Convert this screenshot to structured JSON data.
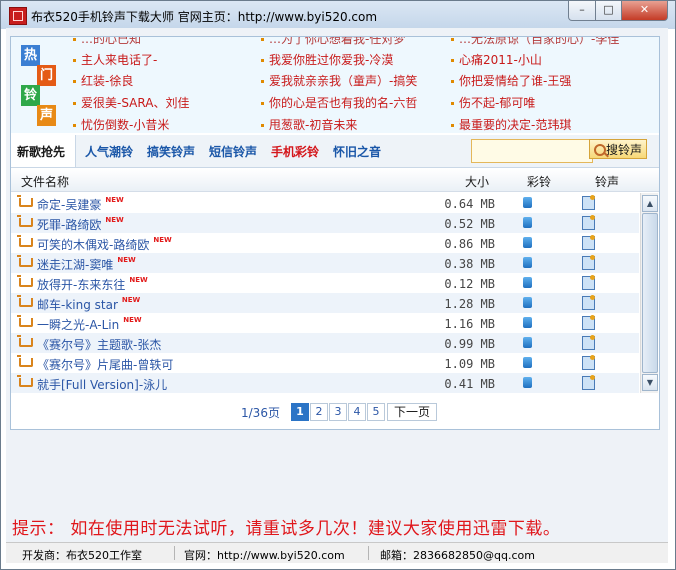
{
  "window": {
    "title": "布衣520手机铃声下载大师  官网主页：http://www.byi520.com",
    "min_label": "–",
    "max_label": "□",
    "close_label": "✕"
  },
  "banner": {
    "tiles": [
      "热",
      "门",
      "铃",
      "声"
    ],
    "tile_colors": [
      "#3b7fd3",
      "#e45b16",
      "#2fa84a",
      "#e88a16"
    ],
    "columns": [
      [
        "主人来电话了-",
        "红装-徐良",
        "爱很美-SARA、刘佳",
        "忧伤倒数-小昔米"
      ],
      [
        "我爱你胜过你爱我-冷漠",
        "爱我就亲亲我（童声）-搞笑",
        "你的心是否也有我的名-六哲",
        "甩葱歌-初音未来"
      ],
      [
        "心痛2011-小山",
        "你把爱情给了谁-王强",
        "伤不起-郁可唯",
        "最重要的决定-范玮琪"
      ]
    ],
    "partial_top": [
      "…的心已知",
      "…为了你心想着我-任对梦",
      "…无法原谅（自家的心）-李佳"
    ]
  },
  "tabs": [
    "新歌抢先",
    "人气潮铃",
    "搞笑铃声",
    "短信铃声",
    "手机彩铃",
    "怀旧之音"
  ],
  "search": {
    "value": "",
    "placeholder": "",
    "button_label": "搜铃声"
  },
  "list": {
    "headers": {
      "name": "文件名称",
      "size": "大小",
      "color_ring": "彩铃",
      "ringtone": "铃声"
    },
    "new_badge": "NEW",
    "rows": [
      {
        "name": "命定-吴建豪",
        "is_new": true,
        "size": "0.64 MB"
      },
      {
        "name": "死罪-路绮欧",
        "is_new": true,
        "size": "0.52 MB"
      },
      {
        "name": "可笑的木偶戏-路绮欧",
        "is_new": true,
        "size": "0.86 MB"
      },
      {
        "name": "迷走江湖-窦唯",
        "is_new": true,
        "size": "0.38 MB"
      },
      {
        "name": "放得开-东来东往",
        "is_new": true,
        "size": "0.12 MB"
      },
      {
        "name": "邮车-king star",
        "is_new": true,
        "size": "1.28 MB"
      },
      {
        "name": "一瞬之光-A-Lin",
        "is_new": true,
        "size": "1.16 MB"
      },
      {
        "name": "《赛尔号》主题歌-张杰",
        "is_new": false,
        "size": "0.99 MB"
      },
      {
        "name": "《赛尔号》片尾曲-曾轶可",
        "is_new": false,
        "size": "1.09 MB"
      },
      {
        "name": "就手[Full Version]-泳儿",
        "is_new": false,
        "size": "0.41 MB"
      }
    ]
  },
  "pager": {
    "info": "1/36页",
    "pages": [
      "1",
      "2",
      "3",
      "4",
      "5"
    ],
    "current": "1",
    "next_label": "下一页"
  },
  "tip": "提示：  如在使用时无法试听，请重试多几次！建议大家使用迅雷下载。",
  "status": {
    "developer": "开发商：布衣520工作室",
    "website": "官网：http://www.byi520.com",
    "email": "邮箱：2836682850@qq.com"
  }
}
